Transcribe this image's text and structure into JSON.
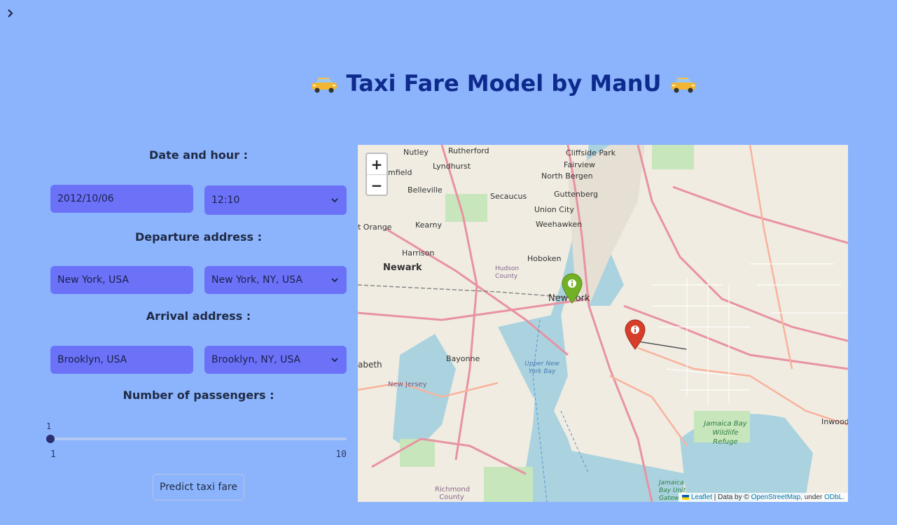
{
  "sidebar": {
    "toggle_icon": "chevron-right-icon"
  },
  "header": {
    "title": "Taxi Fare Model by ManU",
    "taxi_icon": "taxi-icon"
  },
  "form": {
    "date_section_label": "Date and hour :",
    "date_value": "2012/10/06",
    "hour_value": "12:10",
    "departure_section_label": "Departure address :",
    "departure_value": "New York, USA",
    "departure_select": "New York, NY, USA",
    "arrival_section_label": "Arrival address :",
    "arrival_value": "Brooklyn, USA",
    "arrival_select": "Brooklyn, NY, USA",
    "passengers_section_label": "Number of passengers :",
    "passengers_value": "1",
    "passengers_min": "1",
    "passengers_max": "10",
    "predict_button": "Predict taxi fare"
  },
  "map": {
    "zoom_in": "+",
    "zoom_out": "−",
    "labels": {
      "rutherford": "Rutherford",
      "nutley": "Nutley",
      "lyndhurst": "Lyndhurst",
      "cliffside_park": "Cliffside Park",
      "fairview": "Fairview",
      "north_bergen": "North Bergen",
      "belleville": "Belleville",
      "secaucus": "Secaucus",
      "guttenberg": "Guttenberg",
      "union_city": "Union City",
      "weehawken": "Weehawken",
      "kearny": "Kearny",
      "orange": "t Orange",
      "harrison": "Harrison",
      "hoboken": "Hoboken",
      "newark": "Newark",
      "hudson_county": "Hudson County",
      "new_york": "New York",
      "bayonne": "Bayonne",
      "upper_new_york_bay": "Upper New York Bay",
      "new_jersey": "New Jersey",
      "elizabeth": "abeth",
      "jamaica_bay": "Jamaica Bay Wildlife Refuge",
      "inwood": "Inwood",
      "richmond_county": "Richmond County",
      "jamaica_bay_unit": "Jamaica Bay Unit Gatew",
      "bloomfield": "mfield"
    },
    "attribution": {
      "leaflet": "Leaflet",
      "data_by": "| Data by ©",
      "osm": "OpenStreetMap",
      "under": ", under",
      "odbl": "ODbL."
    },
    "departure_marker_color": "#72b026",
    "arrival_marker_color": "#d63e2a"
  },
  "colors": {
    "background": "#8cb4fc",
    "title": "#0e2a8c",
    "input_fill": "#6b72f8"
  }
}
